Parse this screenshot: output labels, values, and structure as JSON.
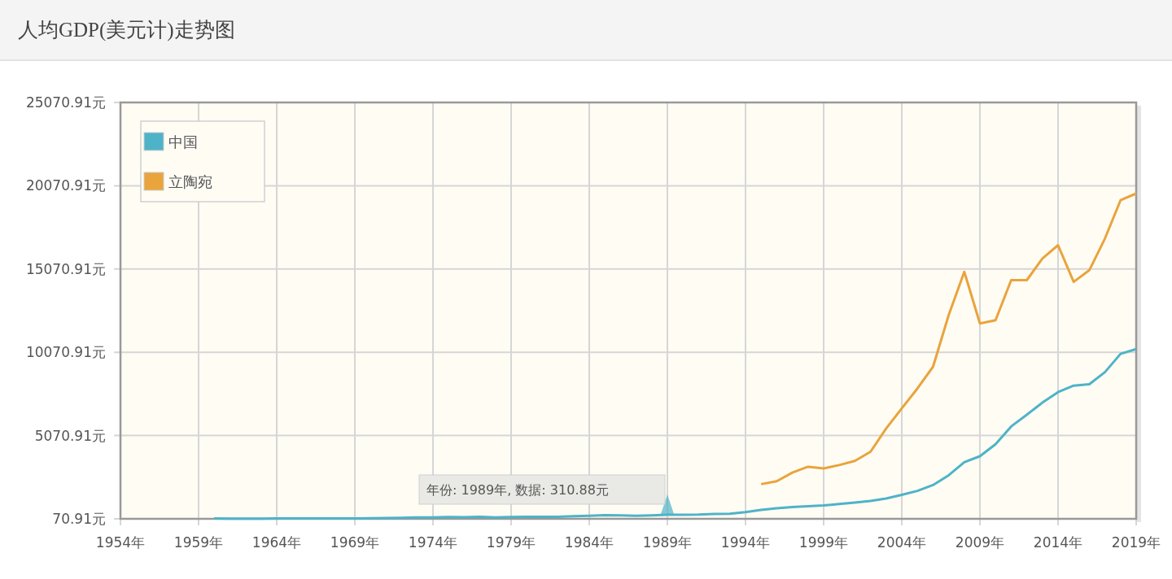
{
  "title": "人均GDP(美元计)走势图",
  "chart": {
    "chart_data": {
      "type": "line",
      "x": [
        1960,
        1961,
        1962,
        1963,
        1964,
        1965,
        1966,
        1967,
        1968,
        1969,
        1970,
        1971,
        1972,
        1973,
        1974,
        1975,
        1976,
        1977,
        1978,
        1979,
        1980,
        1981,
        1982,
        1983,
        1984,
        1985,
        1986,
        1987,
        1988,
        1989,
        1990,
        1991,
        1992,
        1993,
        1994,
        1995,
        1996,
        1997,
        1998,
        1999,
        2000,
        2001,
        2002,
        2003,
        2004,
        2005,
        2006,
        2007,
        2008,
        2009,
        2010,
        2011,
        2012,
        2013,
        2014,
        2015,
        2016,
        2017,
        2018,
        2019
      ],
      "series": [
        {
          "name": "中国",
          "color": "#4eb3c8",
          "values": [
            90,
            80,
            80,
            80,
            90,
            100,
            100,
            100,
            90,
            100,
            110,
            120,
            130,
            160,
            160,
            180,
            170,
            190,
            160,
            180,
            200,
            200,
            200,
            230,
            250,
            290,
            280,
            250,
            280,
            310,
            320,
            330,
            370,
            380,
            470,
            610,
            710,
            780,
            830,
            870,
            960,
            1050,
            1150,
            1290,
            1510,
            1750,
            2100,
            2690,
            3470,
            3830,
            4550,
            5620,
            6320,
            7050,
            7680,
            8070,
            8150,
            8880,
            9980,
            10260
          ]
        },
        {
          "name": "立陶宛",
          "color": "#e9a43c",
          "values": [
            null,
            null,
            null,
            null,
            null,
            null,
            null,
            null,
            null,
            null,
            null,
            null,
            null,
            null,
            null,
            null,
            null,
            null,
            null,
            null,
            null,
            null,
            null,
            null,
            null,
            null,
            null,
            null,
            null,
            null,
            null,
            null,
            null,
            null,
            null,
            2150,
            2330,
            2850,
            3200,
            3100,
            3300,
            3550,
            4100,
            5500,
            6700,
            7900,
            9200,
            12300,
            14900,
            11800,
            12000,
            14400,
            14400,
            15700,
            16500,
            14300,
            15000,
            16900,
            19200,
            19600
          ]
        }
      ],
      "xlim": [
        1954,
        2019
      ],
      "ylim": [
        70.91,
        25070.91
      ],
      "xticks": [
        {
          "value": 1954,
          "label": "1954年"
        },
        {
          "value": 1959,
          "label": "1959年"
        },
        {
          "value": 1964,
          "label": "1964年"
        },
        {
          "value": 1969,
          "label": "1969年"
        },
        {
          "value": 1974,
          "label": "1974年"
        },
        {
          "value": 1979,
          "label": "1979年"
        },
        {
          "value": 1984,
          "label": "1984年"
        },
        {
          "value": 1989,
          "label": "1989年"
        },
        {
          "value": 1994,
          "label": "1994年"
        },
        {
          "value": 1999,
          "label": "1999年"
        },
        {
          "value": 2004,
          "label": "2004年"
        },
        {
          "value": 2009,
          "label": "2009年"
        },
        {
          "value": 2014,
          "label": "2014年"
        },
        {
          "value": 2019,
          "label": "2019年"
        }
      ],
      "yticks": [
        {
          "value": 70.91,
          "label": "70.91元"
        },
        {
          "value": 5070.91,
          "label": "5070.91元"
        },
        {
          "value": 10070.91,
          "label": "10070.91元"
        },
        {
          "value": 15070.91,
          "label": "15070.91元"
        },
        {
          "value": 20070.91,
          "label": "20070.91元"
        },
        {
          "value": 25070.91,
          "label": "25070.91元"
        }
      ],
      "grid": true,
      "legend": true,
      "annotations": [
        "年份: 1989年, 数据: 310.88元"
      ]
    }
  }
}
